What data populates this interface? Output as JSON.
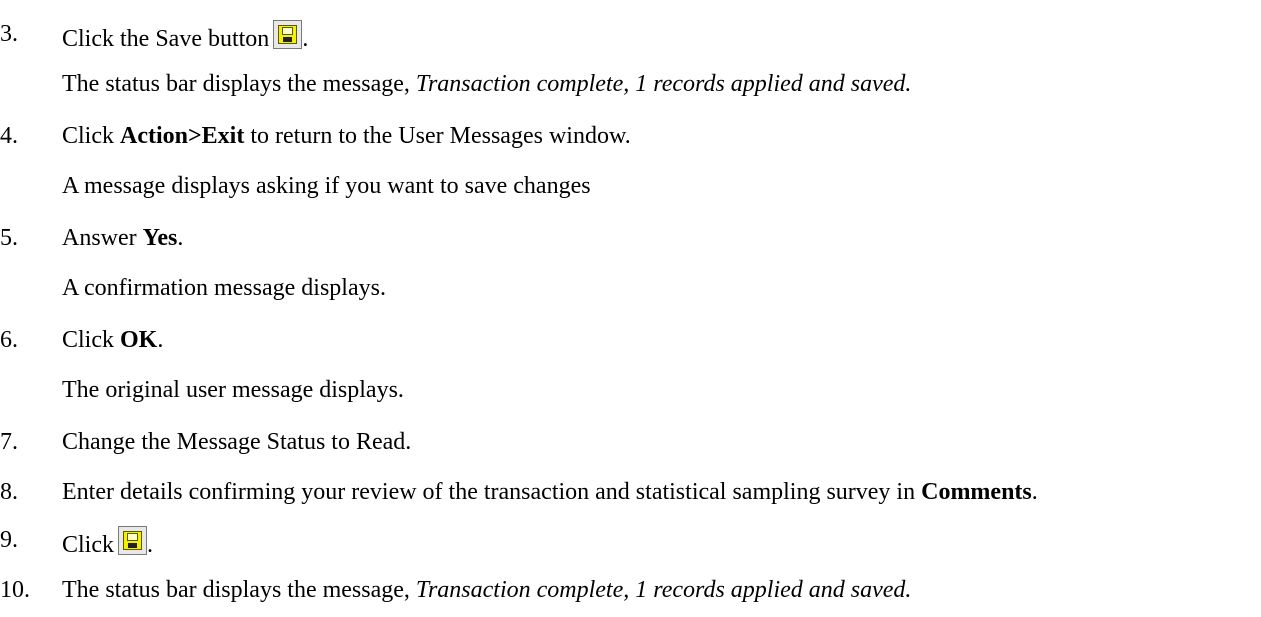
{
  "steps": [
    {
      "num": "3.",
      "pre": "Click the Save button",
      "icon": "save-icon",
      "post": ".",
      "note": {
        "pre": "The status bar displays the message, ",
        "italic": "Transaction complete, 1 records applied and saved."
      }
    },
    {
      "num": "4.",
      "pre": "Click ",
      "bold": "Action>Exit",
      "post": " to return to the User Messages window.",
      "note": {
        "text": "A message displays asking if you want to save changes"
      }
    },
    {
      "num": "5.",
      "pre": "Answer ",
      "bold": "Yes",
      "post": ".",
      "note": {
        "text": "A confirmation message displays."
      }
    },
    {
      "num": "6.",
      "pre": "Click ",
      "bold": "OK",
      "post": ".",
      "note": {
        "text": "The original user message displays."
      }
    },
    {
      "num": "7.",
      "text": "Change the Message Status to Read."
    },
    {
      "num": "8.",
      "pre": "Enter details confirming your review of the transaction and statistical sampling survey in ",
      "bold": "Comments",
      "post": "."
    },
    {
      "num": "9.",
      "pre": "Click",
      "icon": "save-icon",
      "post": "."
    },
    {
      "num": "10.",
      "pre": "The status bar displays the message, ",
      "italic": "Transaction complete, 1 records applied and saved."
    }
  ]
}
